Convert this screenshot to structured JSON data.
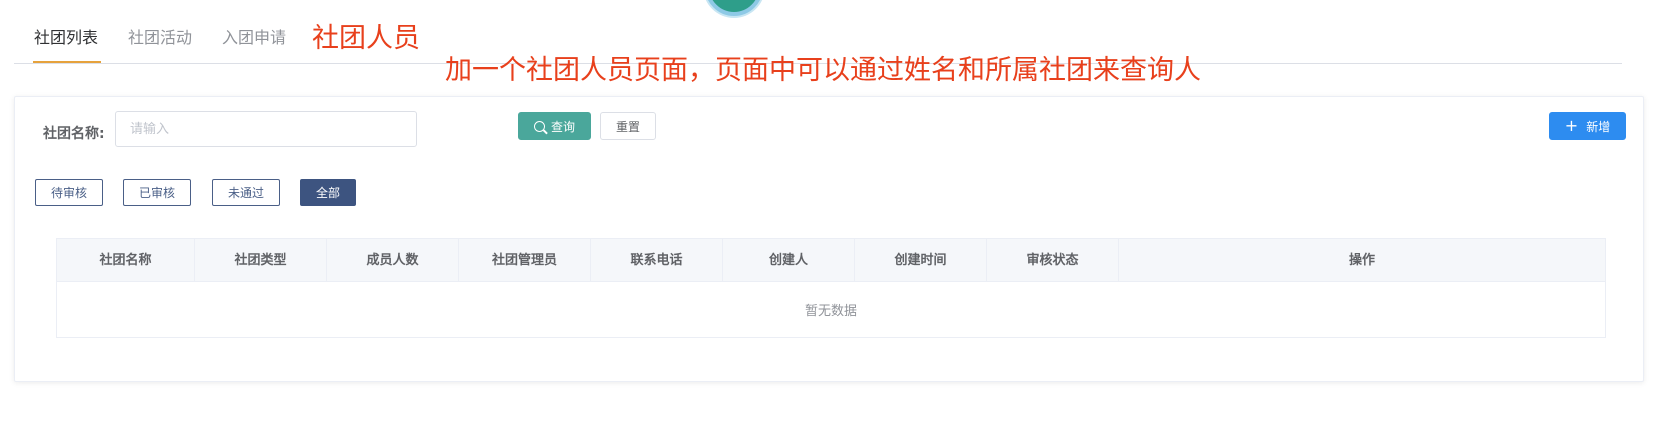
{
  "tabs": [
    {
      "label": "社团列表",
      "active": true
    },
    {
      "label": "社团活动",
      "active": false
    },
    {
      "label": "入团申请",
      "active": false
    }
  ],
  "annotations": {
    "title": "社团人员",
    "note": "加一个社团人员页面，页面中可以通过姓名和所属社团来查询人"
  },
  "filter": {
    "label": "社团名称:",
    "placeholder": "请输入",
    "value": ""
  },
  "buttons": {
    "query": "查询",
    "reset": "重置",
    "add": "新增"
  },
  "status_filters": [
    {
      "label": "待审核",
      "active": false
    },
    {
      "label": "已审核",
      "active": false
    },
    {
      "label": "未通过",
      "active": false
    },
    {
      "label": "全部",
      "active": true
    }
  ],
  "table": {
    "columns": [
      "社团名称",
      "社团类型",
      "成员人数",
      "社团管理员",
      "联系电话",
      "创建人",
      "创建时间",
      "审核状态",
      "操作"
    ],
    "rows": [],
    "empty_text": "暂无数据"
  },
  "colors": {
    "accent_tab": "#e6a23c",
    "query_button": "#4aa79b",
    "add_button": "#2d8cf0",
    "status_active": "#3d5480",
    "annotation": "#e8401c"
  },
  "icons": {
    "query": "search-icon",
    "add": "plus-icon"
  }
}
